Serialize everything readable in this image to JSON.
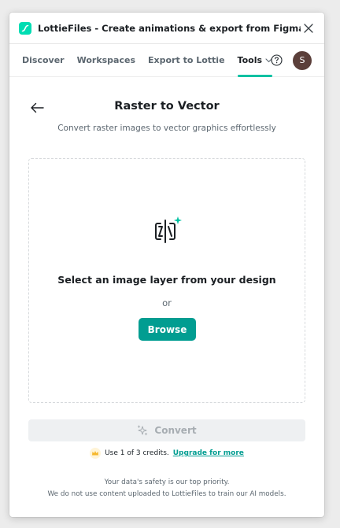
{
  "window": {
    "title": "LottieFiles - Create animations & export from Figma to Lottie"
  },
  "nav": {
    "items": [
      {
        "label": "Discover"
      },
      {
        "label": "Workspaces"
      },
      {
        "label": "Export to Lottie"
      },
      {
        "label": "Tools"
      }
    ],
    "active": "Tools",
    "avatar_initial": "S"
  },
  "page": {
    "title": "Raster to Vector",
    "subtitle": "Convert raster images to vector graphics effortlessly"
  },
  "dropzone": {
    "heading": "Select an image layer from your design",
    "or_text": "or",
    "browse_label": "Browse"
  },
  "convert": {
    "label": "Convert"
  },
  "credits": {
    "text": "Use 1 of 3 credits.",
    "upgrade_label": "Upgrade for more"
  },
  "footer": {
    "line1": "Your data's safety is our top priority.",
    "line2": "We do not use content uploaded to LottieFiles to train our AI models."
  },
  "colors": {
    "accent": "#00c1a2",
    "button": "#019d91",
    "avatar": "#5b3f3a"
  }
}
